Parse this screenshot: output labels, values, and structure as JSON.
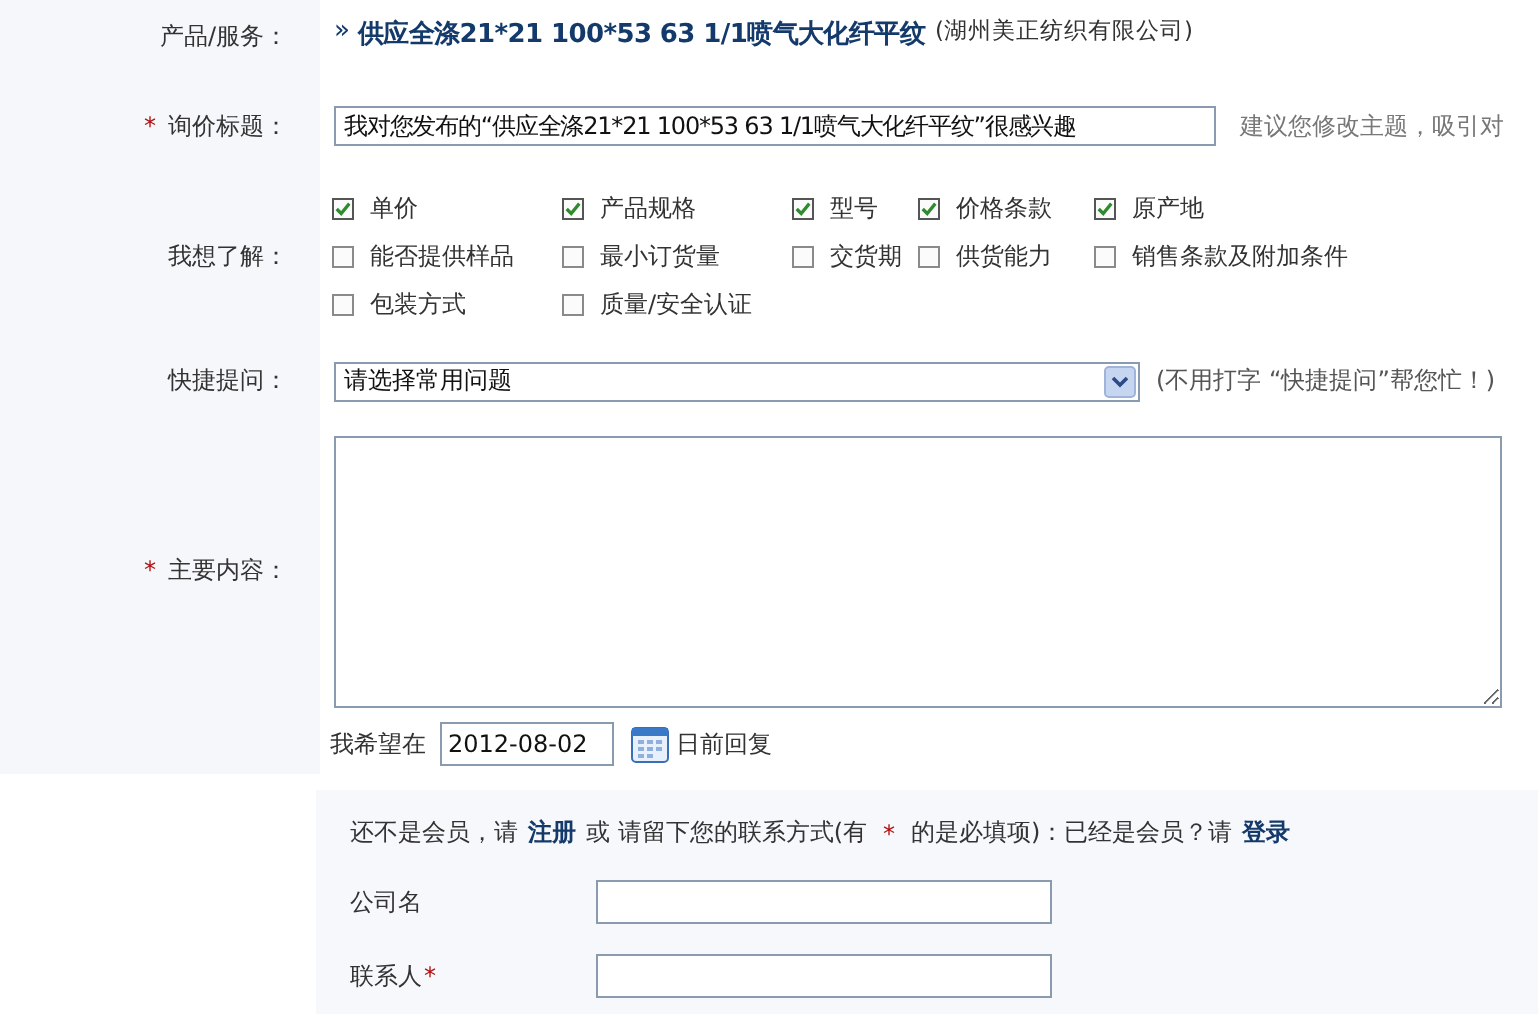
{
  "product": {
    "label": "产品/服务：",
    "prefix": "»",
    "name": "供应全涤21*21 100*53 63 1/1喷气大化纤平纹",
    "company": "(湖州美正纺织有限公司)"
  },
  "subject": {
    "marker": "*",
    "label": "询价标题：",
    "value": "我对您发布的“供应全涤21*21 100*53 63 1/1喷气大化纤平纹”很感兴趣",
    "hint": "建议您修改主题，吸引对"
  },
  "interests": {
    "label": "我想了解：",
    "options": [
      {
        "label": "单价",
        "checked": true
      },
      {
        "label": "产品规格",
        "checked": true
      },
      {
        "label": "型号",
        "checked": true
      },
      {
        "label": "价格条款",
        "checked": true
      },
      {
        "label": "原产地",
        "checked": true
      },
      {
        "label": "能否提供样品",
        "checked": false
      },
      {
        "label": "最小订货量",
        "checked": false
      },
      {
        "label": "交货期",
        "checked": false
      },
      {
        "label": "供货能力",
        "checked": false
      },
      {
        "label": "销售条款及附加条件",
        "checked": false
      },
      {
        "label": "包装方式",
        "checked": false
      },
      {
        "label": "质量/安全认证",
        "checked": false
      }
    ]
  },
  "quick": {
    "label": "快捷提问：",
    "value": "请选择常用问题",
    "hint": "(不用打字 “快捷提问”帮您忙！)"
  },
  "content": {
    "marker": "*",
    "label": "主要内容：",
    "before": "我希望在",
    "date": "2012-08-02",
    "after": "日前回复"
  },
  "contact": {
    "intro": [
      {
        "kind": "text",
        "text": "还不是会员，请"
      },
      {
        "kind": "link",
        "text": "注册"
      },
      {
        "kind": "text",
        "text": "或 请留下您的联系方式(有"
      },
      {
        "kind": "star",
        "text": "*"
      },
      {
        "kind": "text",
        "text": "的是必填项)：已经是会员？请"
      },
      {
        "kind": "link",
        "text": "登录"
      }
    ],
    "fields": [
      {
        "label": "公司名"
      },
      {
        "label": "联系人",
        "marker": "*"
      }
    ]
  }
}
